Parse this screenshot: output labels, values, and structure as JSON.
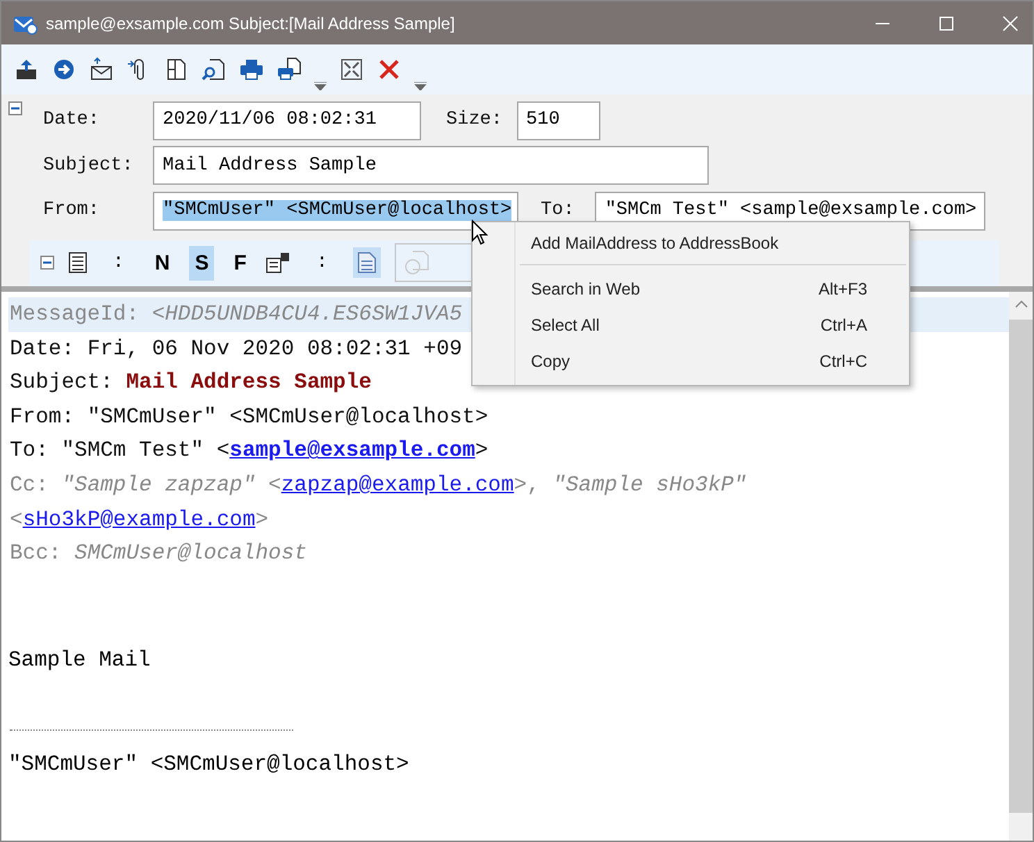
{
  "window": {
    "title": "sample@exsample.com Subject:[Mail Address Sample]"
  },
  "toolbar": [
    {
      "kind": "upload"
    },
    {
      "kind": "forward"
    },
    {
      "kind": "mail"
    },
    {
      "kind": "attach"
    },
    {
      "kind": "doc"
    },
    {
      "kind": "find"
    },
    {
      "kind": "print"
    },
    {
      "kind": "printdoc"
    },
    {
      "kind": "caret"
    },
    {
      "kind": "fit"
    },
    {
      "kind": "delete"
    },
    {
      "kind": "caret"
    }
  ],
  "header": {
    "date": {
      "label": "Date:",
      "value": "2020/11/06 08:02:31"
    },
    "size": {
      "label": "Size:",
      "value": "510"
    },
    "subject": {
      "label": "Subject:",
      "value": "Mail Address Sample"
    },
    "from": {
      "label": "From:",
      "value": "\"SMCmUser\" <SMCmUser@localhost>",
      "selected": true
    },
    "to": {
      "label": "To:",
      "value": "\"SMCm Test\" <sample@exsample.com>",
      "selected": false
    }
  },
  "format_bar": {
    "items": [
      {
        "kind": "list"
      },
      {
        "kind": "sep",
        "text": ":"
      },
      {
        "kind": "toggle",
        "text": "N",
        "selected": false
      },
      {
        "kind": "toggle",
        "text": "S",
        "selected": true
      },
      {
        "kind": "toggle",
        "text": "F",
        "selected": false
      },
      {
        "kind": "grid"
      },
      {
        "kind": "sep",
        "text": ":"
      },
      {
        "kind": "page",
        "selected": true
      }
    ]
  },
  "body": {
    "headers": [
      {
        "label": "MessageId:",
        "dim": true,
        "highlighted": true,
        "parts": [
          {
            "kind": "italic",
            "text": "<HDD5UNDB4CU4.ES6SW1JVA5"
          }
        ]
      },
      {
        "label": "Date:",
        "dim": false,
        "highlighted": false,
        "parts": [
          {
            "kind": "plain",
            "text": "Fri, 06 Nov 2020 08:02:31 +09"
          }
        ]
      },
      {
        "label": "Subject:",
        "dim": false,
        "highlighted": false,
        "parts": [
          {
            "kind": "strong",
            "text": "Mail Address Sample"
          }
        ]
      },
      {
        "label": "From:",
        "dim": false,
        "highlighted": false,
        "parts": [
          {
            "kind": "plain",
            "text": "\"SMCmUser\" <SMCmUser@localhost>"
          }
        ]
      },
      {
        "label": "To:",
        "dim": false,
        "highlighted": false,
        "parts": [
          {
            "kind": "plain",
            "text": "\"SMCm Test\" <"
          },
          {
            "kind": "link_bold",
            "text": "sample@exsample.com"
          },
          {
            "kind": "plain",
            "text": ">"
          }
        ]
      },
      {
        "label": "Cc:",
        "dim": true,
        "highlighted": false,
        "parts": [
          {
            "kind": "italic",
            "text": "\"Sample zapzap\""
          },
          {
            "kind": "dim",
            "text": " <"
          },
          {
            "kind": "link",
            "text": "zapzap@example.com"
          },
          {
            "kind": "dim",
            "text": ">, "
          },
          {
            "kind": "italic",
            "text": "\"Sample sHo3kP\""
          },
          {
            "kind": "dim",
            "text": " <"
          },
          {
            "kind": "link",
            "text": "sHo3kP@example.com"
          },
          {
            "kind": "dim",
            "text": ">"
          }
        ]
      },
      {
        "label": "Bcc:",
        "dim": true,
        "highlighted": false,
        "parts": [
          {
            "kind": "italic",
            "text": "SMCmUser@localhost"
          }
        ]
      }
    ],
    "text": "Sample Mail",
    "signature": "\"SMCmUser\" <SMCmUser@localhost>"
  },
  "context_menu": {
    "items": [
      {
        "kind": "item",
        "label": "Add MailAddress to AddressBook"
      },
      {
        "kind": "separator"
      },
      {
        "kind": "item",
        "label": "Search in Web",
        "shortcut": "Alt+F3"
      },
      {
        "kind": "item",
        "label": "Select All",
        "shortcut": "Ctrl+A"
      },
      {
        "kind": "item",
        "label": "Copy",
        "shortcut": "Ctrl+C"
      }
    ]
  }
}
